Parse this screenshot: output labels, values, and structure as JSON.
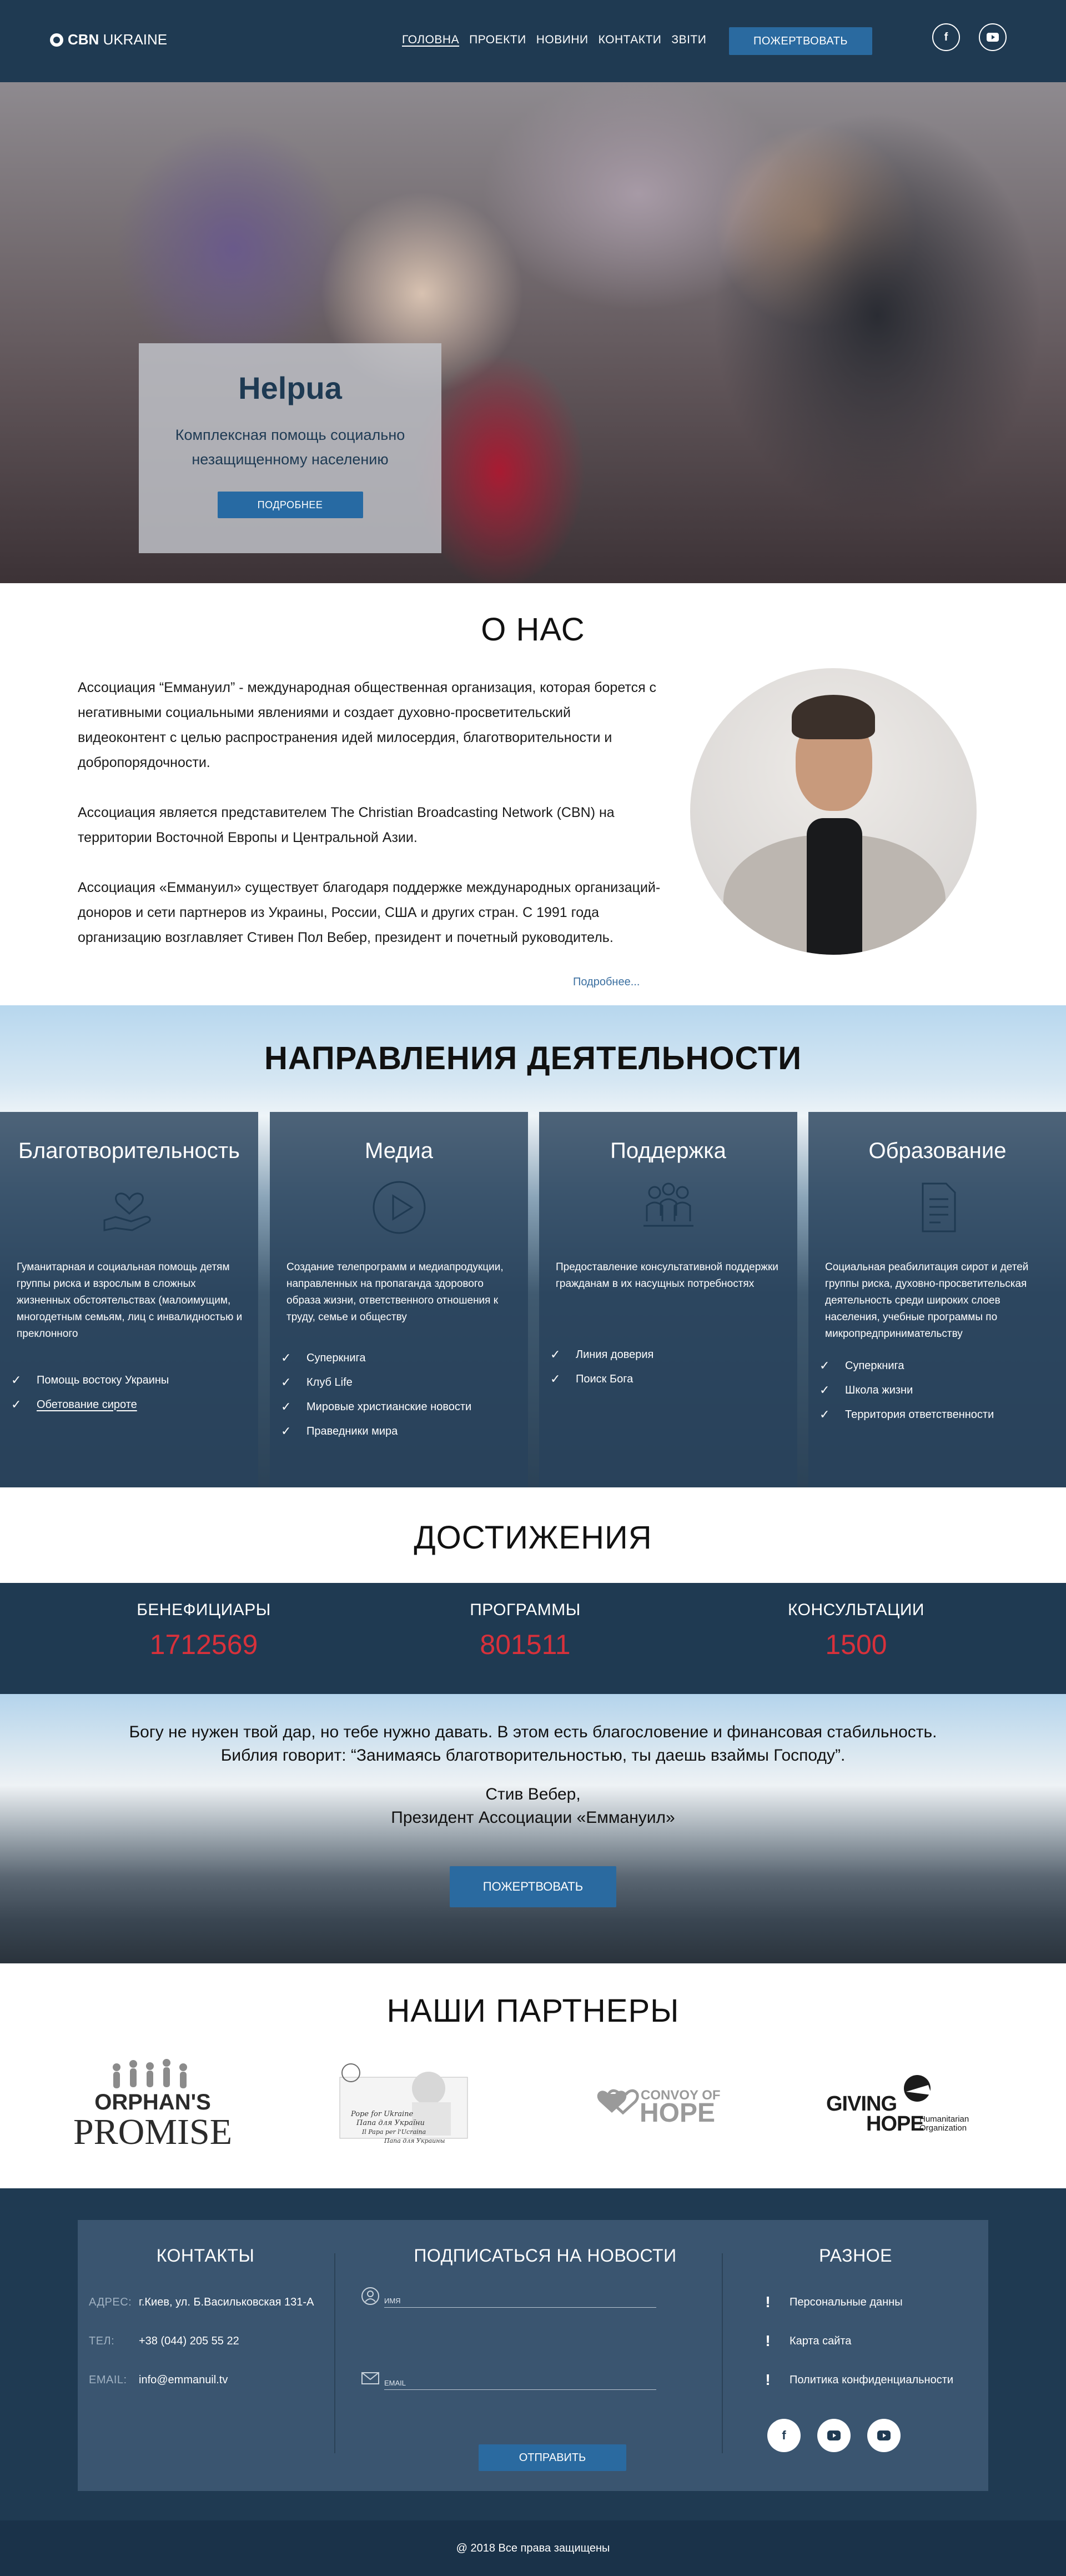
{
  "header": {
    "logo_text_bold": "CBN",
    "logo_text": " UKRAINE",
    "nav": [
      "ГОЛОВНА",
      "ПРОЕКТИ",
      "НОВИНИ",
      "КОНТАКТИ",
      "ЗВІТИ"
    ],
    "donate_label": "ПОЖЕРТВОВАТЬ",
    "social": [
      "facebook-icon",
      "youtube-icon"
    ]
  },
  "hero": {
    "title": "Helpua",
    "subtitle": "Комплексная помощь социально незащищенному населению",
    "button_label": "ПОДРОБНЕЕ"
  },
  "about": {
    "title": "О НАС",
    "paragraphs": [
      "Ассоциация “Еммануил” - международная общественная организация, которая борется с негативными социальными явлениями и создает духовно-просветительский видеоконтент с целью распространения идей милосердия, благотворительности и добропорядочности.",
      " Ассоциация является представителем The Christian Broadcasting Network (CBN) на территории Восточной Европы и Центральной Азии.",
      "Ассоциация «Еммануил» существует благодаря поддержке международных организаций-доноров и сети партнеров из Украины, России, США и других стран. С 1991 года организацию возглавляет Стивен Пол Вебер, президент и почетный руководитель."
    ],
    "more_link": "Подробнее..."
  },
  "directions": {
    "title": "НАПРАВЛЕНИЯ ДЕЯТЕЛЬНОСТИ",
    "cards": [
      {
        "title": "Благотворительность",
        "icon": "heart-hand-icon",
        "description": "Гуманитарная и социальная помощь детям группы риска и взрослым в сложных жизненных обстоятельствах (малоимущим, многодетным семьям, лиц с инвалидностью и преклонного",
        "items": [
          "Помощь востоку Украины",
          "Обетование сироте"
        ]
      },
      {
        "title": "Медиа",
        "icon": "play-icon",
        "description": "Создание телепрограмм и медиапродукции, направленных на пропаганда здорового образа жизни, ответственного отношения к труду, семье и обществу",
        "items": [
          "Суперкнига",
          "Клуб Life",
          "Мировые христианские новости",
          "Праведники мира"
        ]
      },
      {
        "title": "Поддержка",
        "icon": "group-icon",
        "description": "Предоставление консультативной поддержки гражданам в их насущных потребностях",
        "items": [
          "Линия доверия",
          "Поиск Бога"
        ]
      },
      {
        "title": "Образование",
        "icon": "document-icon",
        "description": "Социальная реабилитация сирот и детей группы риска, духовно-просветительская деятельность среди широких слоев населения, учебные программы по микропредпринимательству",
        "items": [
          "Суперкнига",
          "Школа жизни",
          "Территория ответственности"
        ]
      }
    ]
  },
  "achievements": {
    "title": "ДОСТИЖЕНИЯ",
    "stats": [
      {
        "label": "БЕНЕФИЦИАРЫ",
        "value": "1712569"
      },
      {
        "label": "ПРОГРАММЫ",
        "value": "801511"
      },
      {
        "label": "КОНСУЛЬТАЦИИ",
        "value": "1500"
      }
    ]
  },
  "quote": {
    "line1": "Богу не нужен твой дар, но тебе нужно давать. В этом есть благословение и финансовая стабильность.",
    "line2": "Библия говорит: “Занимаясь благотворительностью, ты даешь взаймы Господу”.",
    "author_name": "Стив Вебер,",
    "author_title": "Президент Ассоциации «Еммануил»",
    "button_label": "ПОЖЕРТВОВАТЬ"
  },
  "partners": {
    "title": "НАШИ ПАРТНЕРЫ",
    "logos": [
      {
        "name": "orphans-promise-logo",
        "line1": "ORPHAN'S",
        "line2": "PROMISE"
      },
      {
        "name": "pope-for-ukraine-logo",
        "line1": "Pope for Ukraine",
        "line2": "Папа для України",
        "line3": "Il Papa per l'Ucraina",
        "line4": "Папа для Украины"
      },
      {
        "name": "convoy-of-hope-logo",
        "line1": "CONVOY OF",
        "line2": "HOPE"
      },
      {
        "name": "giving-hope-logo",
        "line1": "GIVING",
        "line2": "HOPE",
        "line3": "Humanitarian",
        "line4": "Organization"
      }
    ]
  },
  "footer": {
    "contacts": {
      "title": "КОНТАКТЫ",
      "rows": [
        {
          "key": "АДРЕС:",
          "value": "г.Киев, ул. Б.Васильковская 131-А"
        },
        {
          "key": "ТЕЛ:",
          "value": "+38 (044) 205 55 22"
        },
        {
          "key": "EMAIL:",
          "value": "info@emmanuil.tv"
        }
      ]
    },
    "subscribe": {
      "title": "ПОДПИСАТЬСЯ НА НОВОСТИ",
      "name_placeholder": "ИМЯ",
      "email_placeholder": "EMAIL",
      "button_label": "ОТПРАВИТЬ"
    },
    "misc": {
      "title": "РАЗНОЕ",
      "items": [
        "Персональные данны",
        "Карта сайта",
        "Политика конфиденциальности"
      ],
      "social": [
        "facebook-icon",
        "youtube-icon",
        "youtube-icon"
      ]
    },
    "copyright": "@ 2018 Все права защищены"
  },
  "colors": {
    "primary_dark": "#1f3a52",
    "button_blue": "#2a6aa0",
    "stat_red": "#d8313b"
  }
}
